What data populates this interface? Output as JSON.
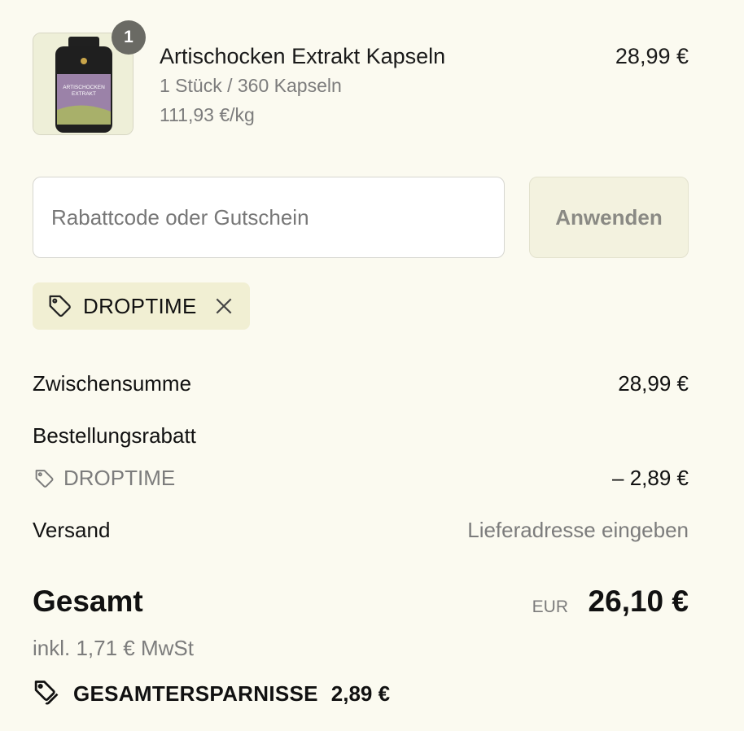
{
  "product": {
    "image_label_line1": "ARTISCHOCKEN",
    "image_label_line2": "EXTRAKT",
    "quantity_badge": "1",
    "title": "Artischocken Extrakt Kapseln",
    "variant": "1 Stück / 360 Kapseln",
    "unit_price": "111,93 €/kg",
    "price": "28,99 €"
  },
  "discount": {
    "placeholder": "Rabattcode oder Gutschein",
    "apply_label": "Anwenden",
    "applied_code": "DROPTIME"
  },
  "summary": {
    "subtotal_label": "Zwischensumme",
    "subtotal_value": "28,99 €",
    "order_discount_label": "Bestellungsrabatt",
    "discount_code": "DROPTIME",
    "discount_value": "– 2,89 €",
    "shipping_label": "Versand",
    "shipping_value": "Lieferadresse eingeben"
  },
  "total": {
    "label": "Gesamt",
    "currency": "EUR",
    "value": "26,10 €",
    "vat_note": "inkl. 1,71 € MwSt",
    "savings_label": "GESAMTERSPARNISSE",
    "savings_value": "2,89 €"
  },
  "colors": {
    "background": "#fbfaf0",
    "chip_background": "#f1efd3",
    "muted_text": "#7c7c7c",
    "bottle_label": "#9b82a8"
  },
  "icons": [
    "tag-icon",
    "close-icon",
    "tags-icon"
  ]
}
